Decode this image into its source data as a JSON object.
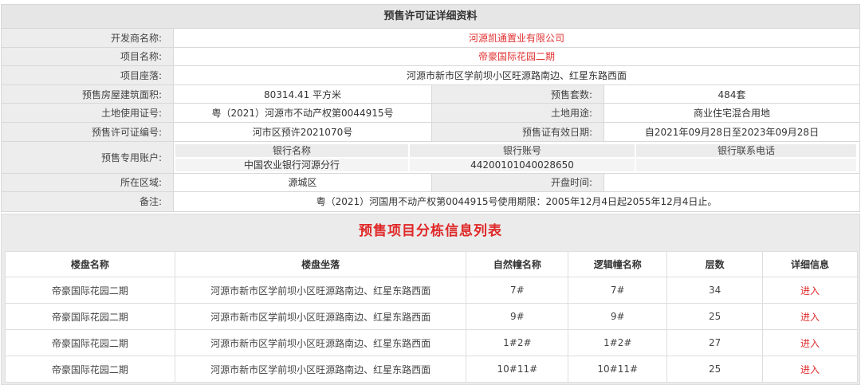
{
  "info": {
    "title": "预售许可证详细资料",
    "developer_label": "开发商名称:",
    "developer": "河源凯通置业有限公司",
    "project_label": "项目名称:",
    "project": "帝豪国际花园二期",
    "location_label": "项目座落:",
    "location": "河源市新市区学前坝小区旺源路南边、红星东路西面",
    "area_label": "预售房屋建筑面积:",
    "area": "80314.41 平方米",
    "units_label": "预售套数:",
    "units": "484套",
    "land_cert_label": "土地使用证号:",
    "land_cert": "粤（2021）河源市不动产权第0044915号",
    "land_use_label": "土地用途:",
    "land_use": "商业住宅混合用地",
    "permit_no_label": "预售许可证编号:",
    "permit_no": "河市区预许2021070号",
    "validity_label": "预售证有效日期:",
    "validity": "自2021年09月28日至2023年09月28日",
    "account_label": "预售专用账户:",
    "bank": {
      "name_header": "银行名称",
      "account_header": "银行账号",
      "phone_header": "银行联系电话",
      "name": "中国农业银行河源分行",
      "account": "44200101040028650",
      "phone": ""
    },
    "district_label": "所在区域:",
    "district": "源城区",
    "open_time_label": "开盘时间:",
    "open_time": "",
    "remark_label": "备注:",
    "remark": "粤（2021）河国用不动产权第0044915号使用期限：2005年12月4日起2055年12月4日止。"
  },
  "buildings": {
    "title": "预售项目分栋信息列表",
    "headers": [
      "楼盘名称",
      "楼盘坐落",
      "自然幢名称",
      "逻辑幢名称",
      "层数",
      "详细信息"
    ],
    "rows": [
      [
        "帝豪国际花园二期",
        "河源市新市区学前坝小区旺源路南边、红星东路西面",
        "7#",
        "7#",
        "34",
        "进入"
      ],
      [
        "帝豪国际花园二期",
        "河源市新市区学前坝小区旺源路南边、红星东路西面",
        "9#",
        "9#",
        "25",
        "进入"
      ],
      [
        "帝豪国际花园二期",
        "河源市新市区学前坝小区旺源路南边、红星东路西面",
        "1#2#",
        "1#2#",
        "27",
        "进入"
      ],
      [
        "帝豪国际花园二期",
        "河源市新市区学前坝小区旺源路南边、红星东路西面",
        "10#11#",
        "10#11#",
        "25",
        "进入"
      ]
    ]
  },
  "colors": {
    "accent_red": "#e03030",
    "label_bg": "#ededed"
  }
}
